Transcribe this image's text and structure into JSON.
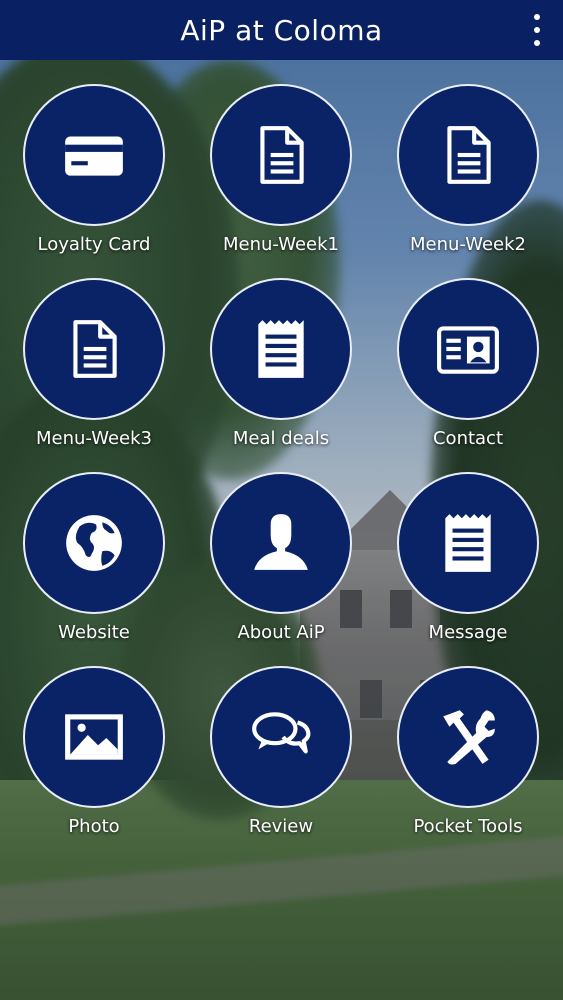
{
  "app_bar": {
    "title": "AiP at Coloma",
    "overflow_icon": "more-vert-icon"
  },
  "colors": {
    "app_bar": "#092062",
    "tile_fill": "#0a2367",
    "tile_border": "#e9edf5",
    "text": "#ffffff"
  },
  "tiles": [
    {
      "label": "Loyalty Card",
      "icon": "credit-card-icon"
    },
    {
      "label": "Menu-Week1",
      "icon": "document-icon"
    },
    {
      "label": "Menu-Week2",
      "icon": "document-icon"
    },
    {
      "label": "Menu-Week3",
      "icon": "document-icon"
    },
    {
      "label": "Meal deals",
      "icon": "notepad-icon"
    },
    {
      "label": "Contact",
      "icon": "contact-card-icon"
    },
    {
      "label": "Website",
      "icon": "globe-icon"
    },
    {
      "label": "About AiP",
      "icon": "person-icon"
    },
    {
      "label": "Message",
      "icon": "notepad-icon"
    },
    {
      "label": "Photo",
      "icon": "image-icon"
    },
    {
      "label": "Review",
      "icon": "chat-bubbles-icon"
    },
    {
      "label": "Pocket Tools",
      "icon": "tools-icon"
    }
  ]
}
